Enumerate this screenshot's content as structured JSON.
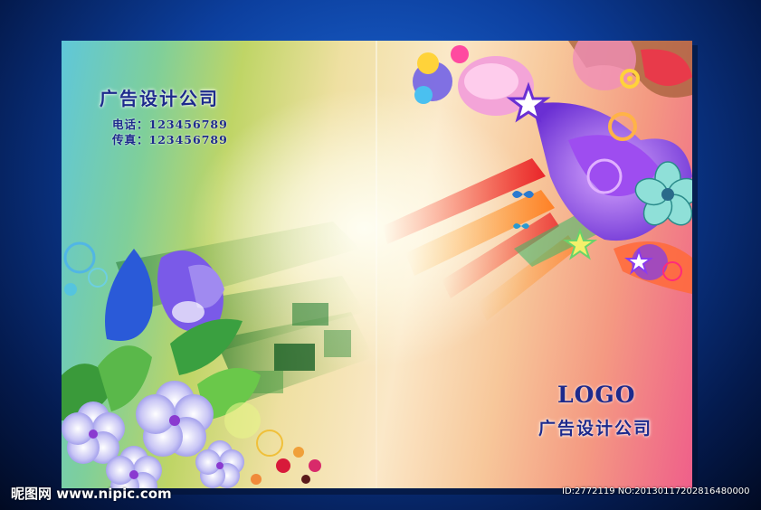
{
  "cover": {
    "back": {
      "company_name": "广告设计公司",
      "phone_label": "电话：",
      "phone_value": "123456789",
      "fax_label": "传真：",
      "fax_value": "123456789"
    },
    "front": {
      "logo_text": "LOGO",
      "company_name": "广告设计公司"
    }
  },
  "watermark": {
    "site_brand": "昵图网",
    "site_url": "www.nipic.com",
    "image_info": "ID:2772119 NO:20130117202816480000"
  },
  "colors": {
    "text_primary": "#1d2a8c",
    "background": "#0c3f9e"
  }
}
